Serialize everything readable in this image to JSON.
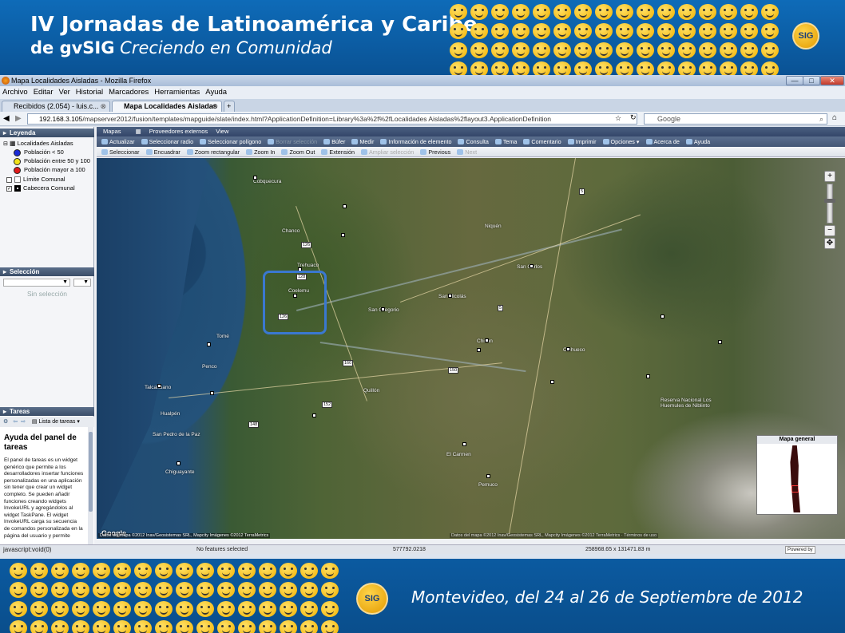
{
  "banner": {
    "title_line1": "IV Jornadas de Latinoamérica y Caribe",
    "title_line2_bold": "de gvSIG",
    "title_line2_italic": "Creciendo en Comunidad",
    "logo_text": "SIG",
    "bottom_text": "Montevideo, del 24 al 26 de Septiembre de 2012"
  },
  "window": {
    "title": "Mapa Localidades Aisladas - Mozilla Firefox",
    "controls": {
      "minimize": "—",
      "maximize": "□",
      "close": "✕"
    }
  },
  "menu": [
    "Archivo",
    "Editar",
    "Ver",
    "Historial",
    "Marcadores",
    "Herramientas",
    "Ayuda"
  ],
  "tabs": [
    {
      "label": "Recibidos (2.054) - luis.c...",
      "close": "⊗"
    },
    {
      "label": "Mapa Localidades Aisladas",
      "close": "⊗"
    }
  ],
  "new_tab": "+",
  "address": {
    "host": "192.168.3.105",
    "path": "/mapserver2012/fusion/templates/mapguide/slate/index.html?ApplicationDefinition=Library%3a%2f%2fLocalidades Aisladas%2flayout3.ApplicationDefinition",
    "search_placeholder": "Google"
  },
  "legend": {
    "title": "Leyenda",
    "group": "Localidades Aisladas",
    "items": [
      {
        "label": "Población < 50",
        "color": "#1a2bd6"
      },
      {
        "label": "Población entre 50 y 100",
        "color": "#f2e21a"
      },
      {
        "label": "Población mayor a 100",
        "color": "#e01a1a"
      }
    ],
    "layers": [
      {
        "label": "Límite Comunal",
        "checked": false
      },
      {
        "label": "Cabecera Comunal",
        "checked": true
      }
    ]
  },
  "selection": {
    "title": "Selección",
    "empty": "Sin selección"
  },
  "tasks": {
    "title": "Tareas",
    "list_label": "Lista de tareas",
    "help_title": "Ayuda del panel de tareas",
    "help_text": "El panel de tareas es un widget genérico que permite a los desarrolladores insertar funciones personalizadas en una aplicación sin tener que crear un widget completo. Se pueden añadir funciones creando widgets InvokeURL y agregándolos al widget TaskPane. El widget InvokeURL carga su secuencia de comandos personalizada en la página del usuario y permite"
  },
  "map_menu": [
    "Mapas",
    "Proveedores externos",
    "View"
  ],
  "toolbar1": [
    {
      "label": "Actualizar",
      "enabled": true
    },
    {
      "label": "Seleccionar radio",
      "enabled": true
    },
    {
      "label": "Seleccionar polígono",
      "enabled": true
    },
    {
      "label": "Borrar selección",
      "enabled": false
    },
    {
      "label": "Búfer",
      "enabled": true
    },
    {
      "label": "Medir",
      "enabled": true
    },
    {
      "label": "Información de elemento",
      "enabled": true
    },
    {
      "label": "Consulta",
      "enabled": true
    },
    {
      "label": "Tema",
      "enabled": true
    },
    {
      "label": "Comentario",
      "enabled": true
    },
    {
      "label": "Imprimir",
      "enabled": true
    },
    {
      "label": "Opciones ▾",
      "enabled": true
    },
    {
      "label": "Acerca de",
      "enabled": true
    },
    {
      "label": "Ayuda",
      "enabled": true
    }
  ],
  "toolbar2": [
    {
      "label": "Seleccionar",
      "enabled": true
    },
    {
      "label": "Encuadrar",
      "enabled": true
    },
    {
      "label": "Zoom rectangular",
      "enabled": true
    },
    {
      "label": "Zoom In",
      "enabled": true
    },
    {
      "label": "Zoom Out",
      "enabled": true
    },
    {
      "label": "Extensión",
      "enabled": true
    },
    {
      "label": "Ampliar selección",
      "enabled": false
    },
    {
      "label": "Previous",
      "enabled": true
    },
    {
      "label": "Next",
      "enabled": false
    }
  ],
  "map": {
    "places": [
      "Cobquecura",
      "Chanco",
      "Trehuaco",
      "Coelemu",
      "Niquén",
      "San Carlos",
      "San Nicolás",
      "San Gregorio",
      "Chillán",
      "Coihueco",
      "Talcahuano",
      "Hualpén",
      "Chiguayante",
      "Quillón",
      "El Carmen",
      "Pemuco",
      "Reserva Nacional Los Huemules de Niblinto",
      "San Pedro de la Paz",
      "Penco",
      "Tomé"
    ],
    "routes": [
      "126",
      "128",
      "148",
      "152",
      "150",
      "5",
      "160"
    ],
    "zoom_in": "+",
    "zoom_out": "−",
    "overview_title": "Mapa general",
    "google": "Google",
    "credit": "Datos del mapa ©2012 Inav/Geosistemas SRL, Mapcity Imágenes ©2012 TerraMetrics",
    "credit2": "Datos del mapa ©2012 Inav/Geosistemas SRL, Mapcity Imágenes ©2012 TerraMetrics · Términos de uso"
  },
  "status": {
    "js": "javascript:void(0)",
    "features": "No features selected",
    "coord": "577792.0218",
    "scale": "258968.65 x 131471.83 m",
    "powered": "Powered by"
  }
}
